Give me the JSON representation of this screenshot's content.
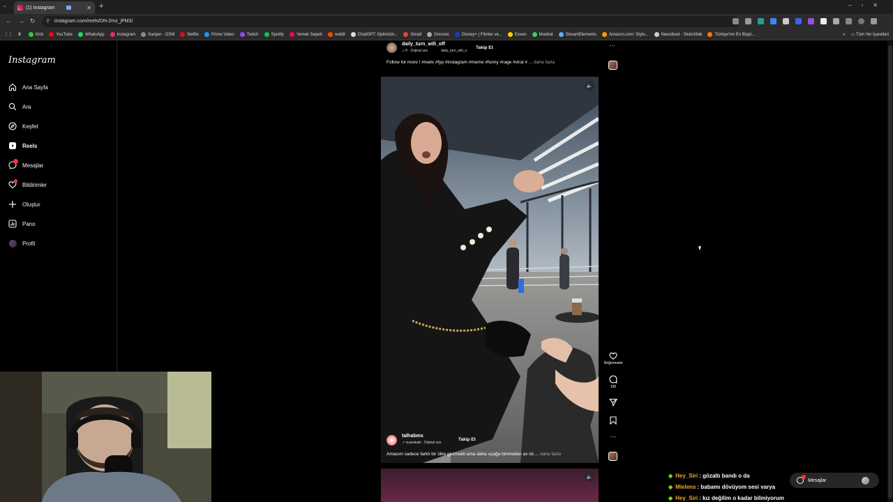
{
  "browser": {
    "tab_title": "(1) Instagram",
    "url": "instagram.com/reels/DN-2mz_jPM3/",
    "bookmarks": [
      "Kick",
      "YouTube",
      "WhatsApp",
      "Instagram",
      "Kariyer - OSM",
      "Netflix",
      "Prime Video",
      "Twitch",
      "Spotify",
      "Yemek Sepeti",
      "reddit",
      "ChatGPT: Optimizin...",
      "Gmail",
      "Gnoosic",
      "Disney+ | Filmler ve...",
      "Exxen",
      "Moobot",
      "StreamElements",
      "Amazon.com: Stylo...",
      "Newsfeed - Sketchfab",
      "Türkiye'nin En Büyü..."
    ],
    "bookmark_colors": [
      "#2ecc40",
      "#ff0000",
      "#25d366",
      "#e1306c",
      "#888888",
      "#e50914",
      "#1a98ff",
      "#9146ff",
      "#1db954",
      "#ff0055",
      "#ff4500",
      "#dddddd",
      "#ea4335",
      "#aaaaaa",
      "#113ccf",
      "#ffcc00",
      "#33cc66",
      "#5fa8ff",
      "#ff9900",
      "#cccccc",
      "#ff7a00"
    ],
    "all_bookmarks": "Tüm Yer İşaretleri"
  },
  "sidebar": {
    "logo": "Instagram",
    "items": [
      {
        "label": "Ana Sayfa",
        "icon": "home-icon"
      },
      {
        "label": "Ara",
        "icon": "search-icon"
      },
      {
        "label": "Keşfet",
        "icon": "compass-icon"
      },
      {
        "label": "Reels",
        "icon": "reels-icon"
      },
      {
        "label": "Mesajlar",
        "icon": "messenger-icon"
      },
      {
        "label": "Bildirimler",
        "icon": "heart-icon"
      },
      {
        "label": "Oluştur",
        "icon": "plus-icon"
      },
      {
        "label": "Pano",
        "icon": "dashboard-icon"
      },
      {
        "label": "Profil",
        "icon": "profile-avatar"
      }
    ]
  },
  "reel_prev": {
    "username": "daily_turn_wifi_off",
    "audio": "♫ ft · Orijinal ses",
    "audio_owner": "daily_turn_wifi_o",
    "follow": "Takip Et",
    "caption": "Follow for more ! #reels #fyp #instagram #meme #funny #rage #viral # ...",
    "more": "daha fazla"
  },
  "reel": {
    "username": "talhabmx",
    "audio": "↗ suanakab · Orijinal ses",
    "follow": "Takip Et",
    "caption": "Amacım sadece farklı bir ülke gezmekti ama daha uçağa binmeden av olı ...",
    "more": "daha fazla",
    "like_label": "Beğenmeler",
    "comment_count": "190"
  },
  "chat": [
    {
      "user": "Hey_Siri",
      "text": ": gözaltı bandı o da"
    },
    {
      "user": "Mielens",
      "text": ": babamı dövüyom sesi varya"
    },
    {
      "user": "Hey_Siri",
      "text": ": kız değilim o kadar bilmiyorum"
    }
  ],
  "messages_pill": {
    "label": "Mesajlar"
  },
  "colors": {
    "accent": "#ff3040",
    "chat_user": "#f5a623",
    "chat_gem": "#7ed321"
  }
}
